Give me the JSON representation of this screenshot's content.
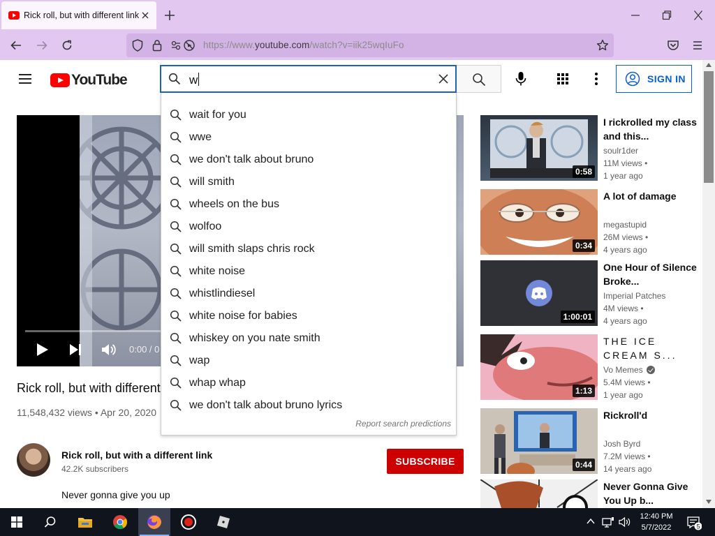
{
  "browser": {
    "tab_title": "Rick roll, but with different link",
    "url_prefix": "https://www.",
    "url_domain": "youtube.com",
    "url_suffix": "/watch?v=iik25wqIuFo"
  },
  "youtube": {
    "logo_text": "YouTube",
    "search_value": "w",
    "sign_in_label": "SIGN IN"
  },
  "suggestions": {
    "items": [
      "wait for you",
      "wwe",
      "we don't talk about bruno",
      "will smith",
      "wheels on the bus",
      "wolfoo",
      "will smith slaps chris rock",
      "white noise",
      "whistlindiesel",
      "white noise for babies",
      "whiskey on you nate smith",
      "wap",
      "whap whap",
      "we don't talk about bruno lyrics"
    ],
    "report_label": "Report search predictions"
  },
  "video": {
    "time_display": "0:00 / 0",
    "title": "Rick roll, but with different",
    "meta": "11,548,432 views • Apr 20, 2020",
    "channel_name": "Rick roll, but with a different link",
    "subscribers": "42.2K subscribers",
    "subscribe_label": "SUBSCRIBE",
    "description": "Never gonna give you up"
  },
  "related": [
    {
      "title": "I rickrolled my class and this...",
      "channel": "soulr1der",
      "views": "11M views •",
      "age": "1 year ago",
      "duration": "0:58",
      "verified": false
    },
    {
      "title": "A lot of damage",
      "channel": "megastupid",
      "views": "26M views •",
      "age": "4 years ago",
      "duration": "0:34",
      "verified": false
    },
    {
      "title": "One Hour of Silence Broke...",
      "channel": "Imperial Patches",
      "views": "4M views •",
      "age": "4 years ago",
      "duration": "1:00:01",
      "verified": false
    },
    {
      "title": "THE ICE CREAM S...",
      "channel": "Vo Memes",
      "views": "5.4M views •",
      "age": "1 year ago",
      "duration": "1:13",
      "verified": true
    },
    {
      "title": "Rickroll'd",
      "channel": "Josh Byrd",
      "views": "7.2M views •",
      "age": "14 years ago",
      "duration": "0:44",
      "verified": false
    },
    {
      "title": "Never Gonna Give You Up b...",
      "channel": "",
      "views": "",
      "age": "",
      "duration": "",
      "verified": false
    }
  ],
  "taskbar": {
    "time": "12:40 PM",
    "date": "5/7/2022",
    "notification_count": "5"
  },
  "colors": {
    "browser_chrome": "#e2c7f0",
    "youtube_red": "#ff0000",
    "subscribe_red": "#cc0000",
    "link_blue": "#065fd4",
    "search_focus": "#1c62b9"
  }
}
